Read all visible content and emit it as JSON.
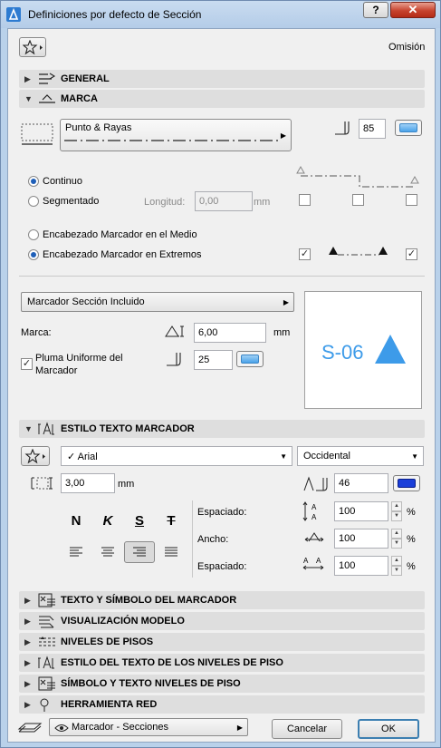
{
  "window": {
    "title": "Definiciones por defecto de Sección",
    "help": "?",
    "close": "✕"
  },
  "topbar": {
    "omision": "Omisión"
  },
  "sections": {
    "general": "GENERAL",
    "marca": "MARCA",
    "estilo_texto": "ESTILO TEXTO MARCADOR",
    "texto_simbolo": "TEXTO Y SÍMBOLO DEL MARCADOR",
    "visualizacion": "VISUALIZACIÓN MODELO",
    "niveles": "NIVELES DE PISOS",
    "estilo_niveles": "ESTILO DEL TEXTO DE LOS NIVELES DE PISO",
    "simbolo_niveles": "SÍMBOLO Y TEXTO NIVELES DE PISO",
    "herramienta": "HERRAMIENTA RED"
  },
  "marca": {
    "line_type": "Punto & Rayas",
    "pen": "85",
    "continuo": "Continuo",
    "segmentado": "Segmentado",
    "longitud_label": "Longitud:",
    "longitud_value": "0,00",
    "longitud_unit": "mm",
    "encabezado_medio": "Encabezado Marcador en el Medio",
    "encabezado_extremos": "Encabezado Marcador en Extremos"
  },
  "marcador": {
    "dropdown": "Marcador Sección Incluido",
    "marca_label": "Marca:",
    "marca_value": "6,00",
    "marca_unit": "mm",
    "pluma_label_1": "Pluma Uniforme del",
    "pluma_label_2": "Marcador",
    "pluma_value": "25",
    "preview_text": "S-06"
  },
  "texto": {
    "font": "Arial",
    "script": "Occidental",
    "size_value": "3,00",
    "size_unit": "mm",
    "pen_value": "46",
    "bold": "N",
    "italic": "K",
    "underline": "S",
    "strike": "T",
    "espaciado_label": "Espaciado:",
    "espaciado_value": "100",
    "ancho_label": "Ancho:",
    "ancho_value": "100",
    "espaciado2_label": "Espaciado:",
    "espaciado2_value": "100",
    "percent": "%"
  },
  "footer": {
    "view": "Marcador - Secciones",
    "cancel": "Cancelar",
    "ok": "OK"
  },
  "colors": {
    "preview_blue": "#3d9be9",
    "pen_dark": "#1b3fd9"
  }
}
